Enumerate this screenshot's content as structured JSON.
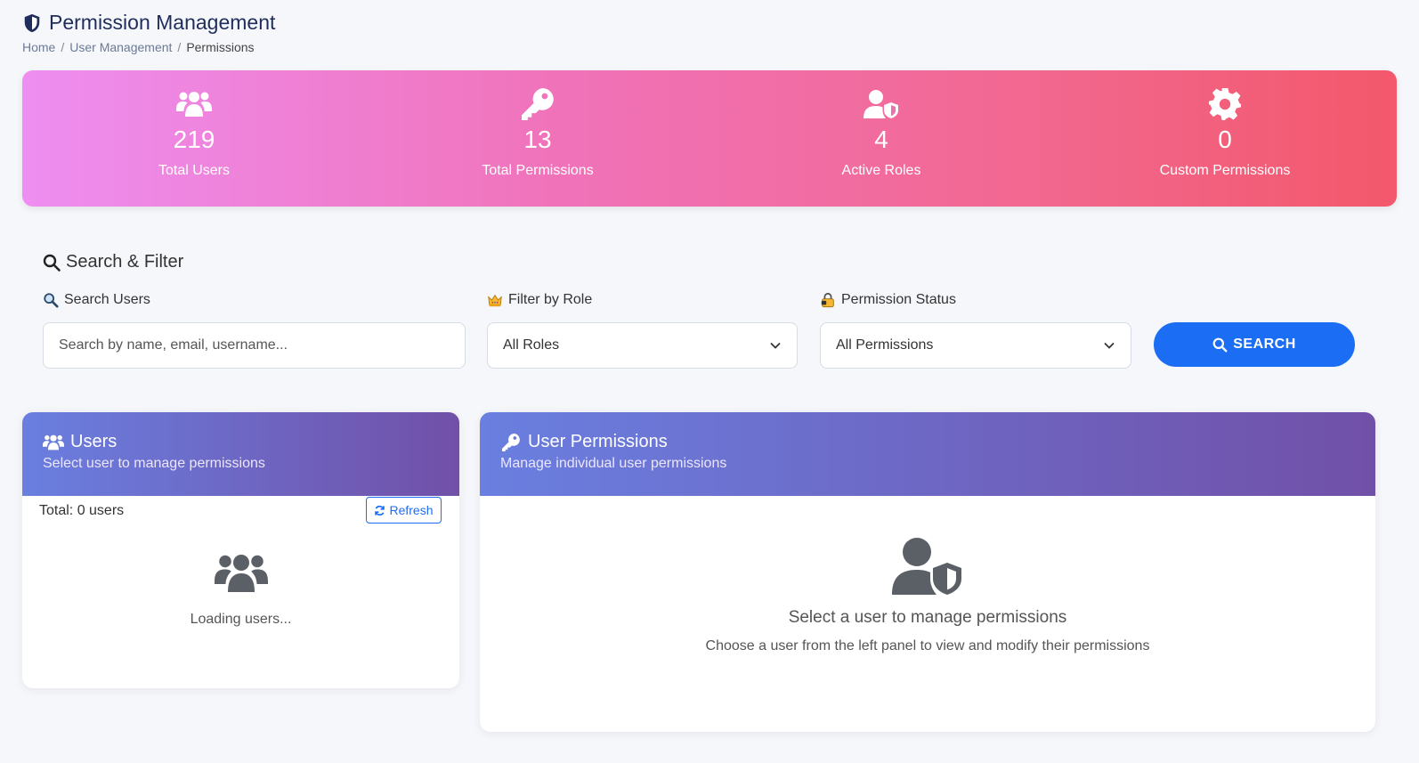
{
  "header": {
    "title": "Permission Management",
    "breadcrumb": [
      "Home",
      "User Management",
      "Permissions"
    ],
    "icon": "shield-icon"
  },
  "stats": [
    {
      "icon": "users-icon",
      "value": "219",
      "label": "Total Users"
    },
    {
      "icon": "key-icon",
      "value": "13",
      "label": "Total Permissions"
    },
    {
      "icon": "user-shield-icon",
      "value": "4",
      "label": "Active Roles"
    },
    {
      "icon": "gear-icon",
      "value": "0",
      "label": "Custom Permissions"
    }
  ],
  "filter": {
    "title": "Search & Filter",
    "search": {
      "label": "Search Users",
      "placeholder": "Search by name, email, username..."
    },
    "role": {
      "label": "Filter by Role",
      "selected": "All Roles",
      "icon": "crown-icon"
    },
    "status": {
      "label": "Permission Status",
      "selected": "All Permissions",
      "icon": "lock-icon"
    },
    "search_button": "SEARCH"
  },
  "users_panel": {
    "title": "Users",
    "subtitle": "Select user to manage permissions",
    "total": "Total: 0 users",
    "refresh": "Refresh",
    "loading": "Loading users..."
  },
  "permissions_panel": {
    "title": "User Permissions",
    "subtitle": "Manage individual user permissions",
    "empty_title": "Select a user to manage permissions",
    "empty_desc": "Choose a user from the left panel to view and modify their permissions"
  },
  "colors": {
    "primary": "#1b6ef3",
    "banner_start": "#ee8ef1",
    "banner_end": "#f3586b",
    "panel_header_start": "#6a7fe0",
    "panel_header_end": "#7150a8"
  }
}
